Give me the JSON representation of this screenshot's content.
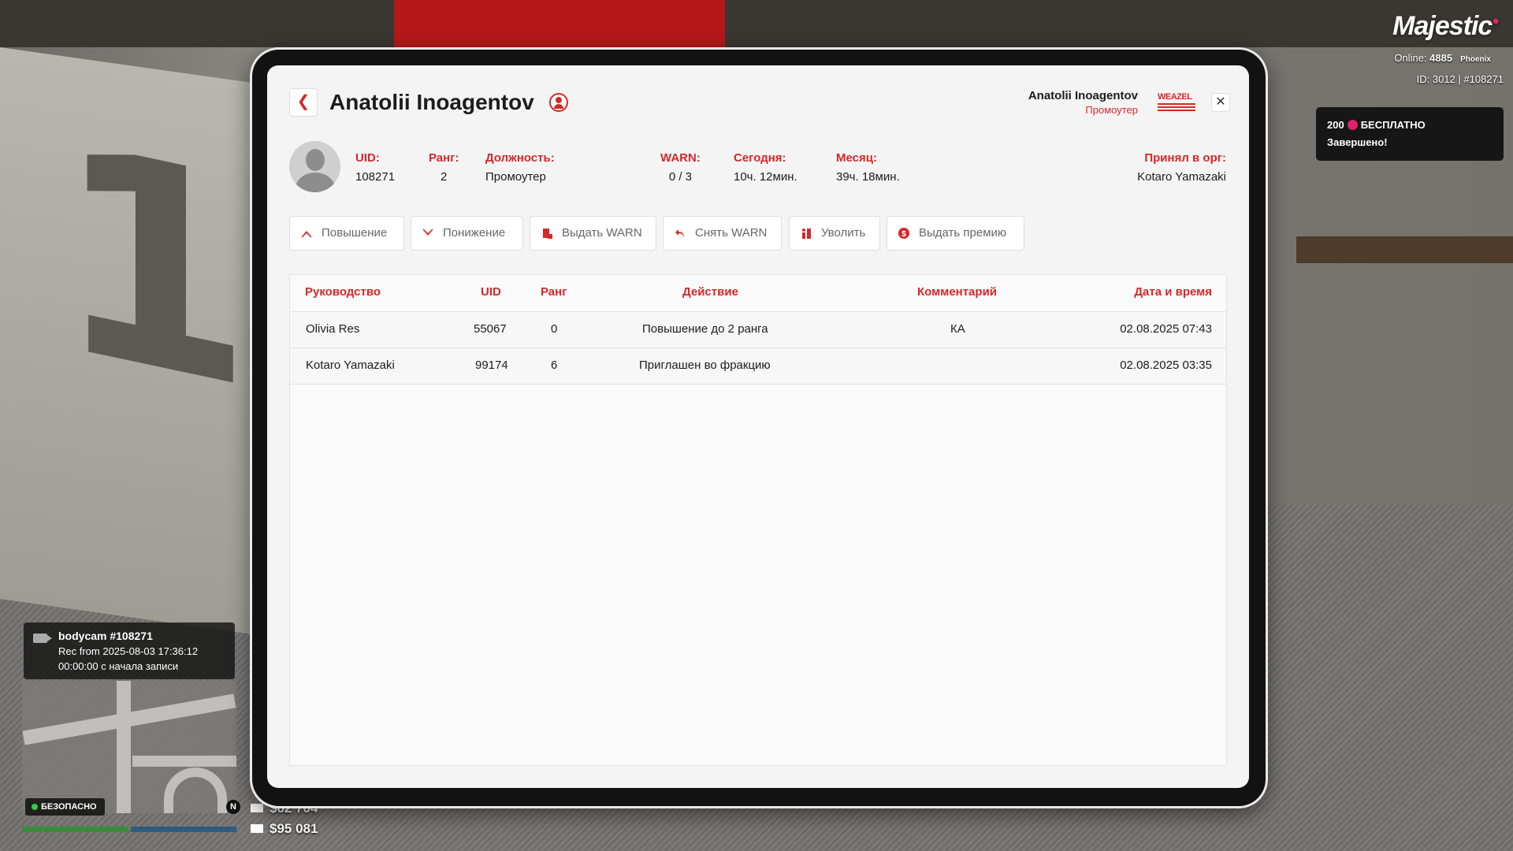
{
  "hud": {
    "logo": "Majestic",
    "online_label": "Online:",
    "online_count": "4885",
    "server": "Phoenix",
    "id_text": "ID: 3012 | #108271",
    "notify_amount": "200",
    "notify_text": "БЕСПЛАТНО",
    "notify_status": "Завершено!",
    "bodycam_title": "bodycam #108271",
    "bodycam_rec": "Rec from 2025-08-03 17:36:12",
    "bodycam_time": "00:00:00 с начала записи",
    "zone_status": "БЕЗОПАСНО",
    "compass": "N",
    "cash": "$62 704",
    "bank": "$95 081"
  },
  "header": {
    "title": "Anatolii Inoagentov",
    "user_name": "Anatolii Inoagentov",
    "user_role": "Промоутер",
    "org_logo_text": "WEAZEL NEWS"
  },
  "profile": {
    "uid_label": "UID:",
    "uid": "108271",
    "rank_label": "Ранг:",
    "rank": "2",
    "position_label": "Должность:",
    "position": "Промоутер",
    "warn_label": "WARN:",
    "warn": "0 / 3",
    "today_label": "Сегодня:",
    "today": "10ч. 12мин.",
    "month_label": "Месяц:",
    "month": "39ч. 18мин.",
    "accepted_label": "Принял в орг:",
    "accepted_by": "Kotaro Yamazaki"
  },
  "actions": {
    "promote": "Повышение",
    "demote": "Понижение",
    "give_warn": "Выдать WARN",
    "remove_warn": "Снять WARN",
    "fire": "Уволить",
    "bonus": "Выдать премию"
  },
  "table": {
    "headers": [
      "Руководство",
      "UID",
      "Ранг",
      "Действие",
      "Комментарий",
      "Дата и время"
    ],
    "rows": [
      [
        "Olivia Res",
        "55067",
        "0",
        "Повышение до 2 ранга",
        "КА",
        "02.08.2025 07:43"
      ],
      [
        "Kotaro Yamazaki",
        "99174",
        "6",
        "Приглашен во фракцию",
        "",
        "02.08.2025 03:35"
      ]
    ]
  },
  "colors": {
    "accent": "#d62828",
    "panel": "#f4f4f4",
    "frame": "#121212"
  }
}
